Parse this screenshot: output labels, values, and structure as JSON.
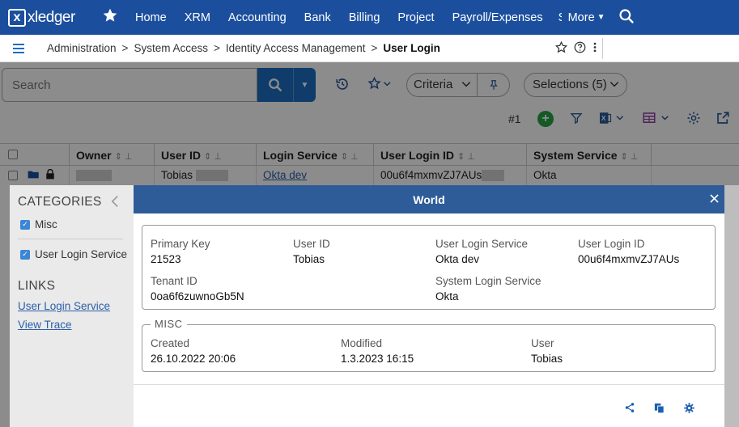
{
  "topnav": {
    "logo_mark": "x",
    "logo_text": "xledger",
    "items": [
      "Home",
      "XRM",
      "Accounting",
      "Bank",
      "Billing",
      "Project",
      "Payroll/Expenses"
    ],
    "cut_item": "S",
    "more_label": "More"
  },
  "breadcrumb": {
    "items": [
      "Administration",
      "System Access",
      "Identity Access Management"
    ],
    "current": "User Login"
  },
  "toolbar": {
    "search_placeholder": "Search",
    "criteria_label": "Criteria",
    "selections_label": "Selections (5)",
    "row_number": "#1"
  },
  "grid": {
    "columns": [
      "Owner",
      "User ID",
      "Login Service",
      "User Login ID",
      "System Service"
    ],
    "row": {
      "user_id": "Tobias",
      "login_service": "Okta dev",
      "user_login_id": "00u6f4mxmvZJ7AUs",
      "system_service": "Okta"
    }
  },
  "sidepanel": {
    "categories_title": "CATEGORIES",
    "categories": [
      "Misc",
      "User Login Service"
    ],
    "links_title": "LINKS",
    "links": [
      "User Login Service",
      "View Trace"
    ]
  },
  "modal": {
    "title": "World",
    "main_fields": {
      "primary_key": {
        "label": "Primary Key",
        "value": "21523"
      },
      "user_id": {
        "label": "User ID",
        "value": "Tobias"
      },
      "user_login_service": {
        "label": "User Login Service",
        "value": "Okta dev"
      },
      "user_login_id": {
        "label": "User Login ID",
        "value": "00u6f4mxmvZJ7AUs"
      },
      "tenant_id": {
        "label": "Tenant ID",
        "value": "0oa6f6zuwnoGb5N"
      },
      "system_login_service": {
        "label": "System Login Service",
        "value": "Okta"
      }
    },
    "misc": {
      "legend": "MISC",
      "created": {
        "label": "Created",
        "value": "26.10.2022 20:06"
      },
      "modified": {
        "label": "Modified",
        "value": "1.3.2023 16:15"
      },
      "user": {
        "label": "User",
        "value": "Tobias"
      }
    }
  },
  "colors": {
    "nav_blue": "#1b4f9e",
    "modal_header": "#2e5c99",
    "accent_blue": "#1c6ec2",
    "add_green": "#27a244"
  }
}
